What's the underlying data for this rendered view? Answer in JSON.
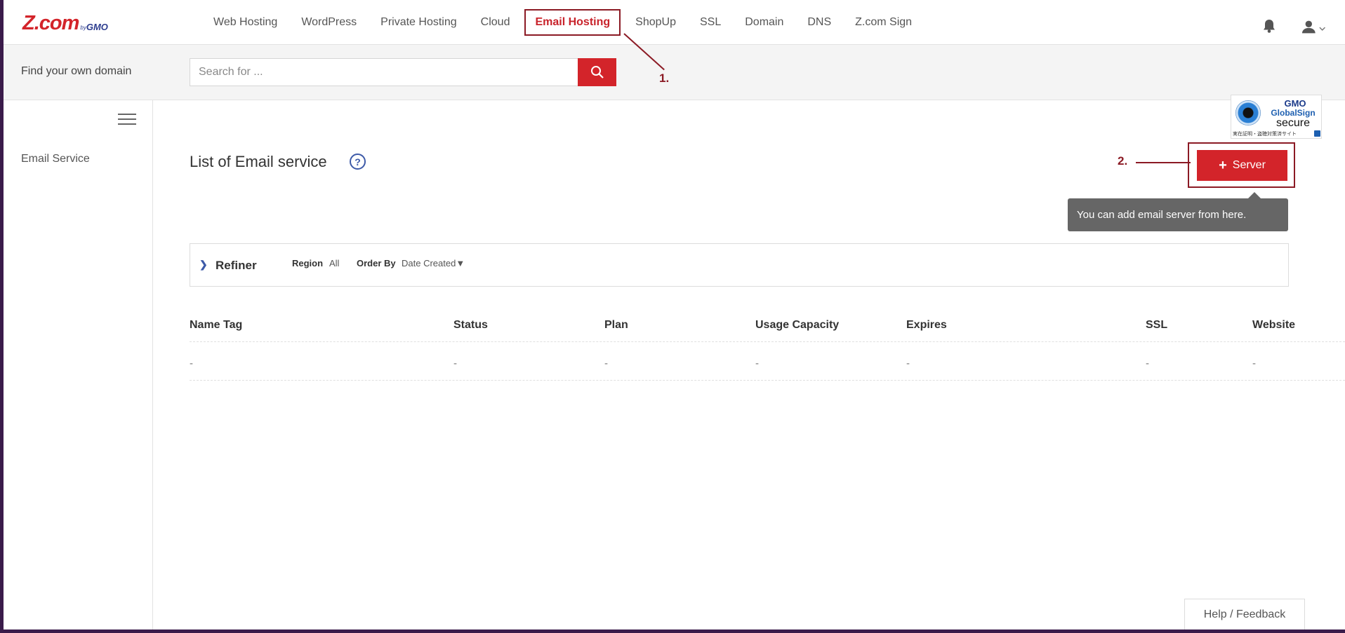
{
  "brand": {
    "logo_main": "Z.com",
    "logo_by": "by",
    "logo_gmo": "GMO"
  },
  "nav": {
    "items": [
      {
        "label": "Web Hosting"
      },
      {
        "label": "WordPress"
      },
      {
        "label": "Private Hosting"
      },
      {
        "label": "Cloud"
      },
      {
        "label": "Email Hosting",
        "active": true
      },
      {
        "label": "ShopUp"
      },
      {
        "label": "SSL"
      },
      {
        "label": "Domain"
      },
      {
        "label": "DNS"
      },
      {
        "label": "Z.com Sign"
      }
    ],
    "icons": [
      "bell-icon",
      "user-icon",
      "chevron-down-icon"
    ]
  },
  "search": {
    "label": "Find your own domain",
    "placeholder": "Search for ...",
    "value": ""
  },
  "badge": {
    "gmo": "GMO",
    "name": "GlobalSign",
    "secure": "secure",
    "caption": "実在証明・盗聴対策済サイト"
  },
  "sidebar": {
    "items": [
      {
        "label": "Email Service"
      }
    ]
  },
  "main": {
    "title": "List of Email service",
    "help_icon": "?",
    "add_button": {
      "icon": "+",
      "label": "Server"
    },
    "tooltip": "You can add email server from here.",
    "refiner": {
      "chevron": "❯",
      "label": "Refiner",
      "region_label": "Region",
      "region_value": "All",
      "order_label": "Order By",
      "order_value": "Date Created▼"
    },
    "table": {
      "columns": [
        "Name Tag",
        "Status",
        "Plan",
        "Usage Capacity",
        "Expires",
        "SSL",
        "Website"
      ],
      "rows": [
        [
          "-",
          "-",
          "-",
          "-",
          "-",
          "-",
          "-"
        ]
      ]
    }
  },
  "annotations": {
    "step1": "1.",
    "step2": "2."
  },
  "footer": {
    "feedback": "Help / Feedback"
  },
  "colors": {
    "brand_red": "#d3242a",
    "annotation": "#8b1a24",
    "link_blue": "#3d5aa8"
  }
}
